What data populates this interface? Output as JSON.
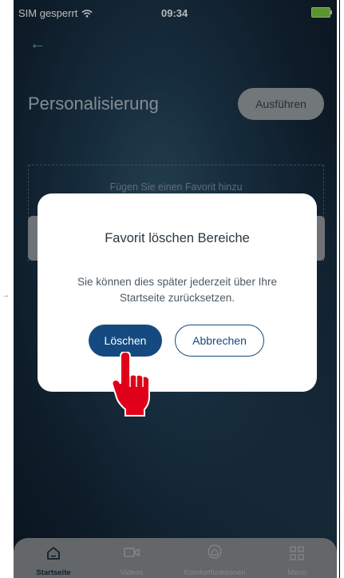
{
  "status_bar": {
    "carrier": "SIM gesperrt",
    "time": "09:34"
  },
  "header": {
    "back_icon": "arrow-left-icon",
    "title": "Personalisierung",
    "run_label": "Ausführen"
  },
  "favorites": {
    "hint": "Fügen Sie einen Favorit hinzu"
  },
  "dialog": {
    "title": "Favorit löschen Bereiche",
    "message": "Sie können dies später jederzeit über Ihre Startseite zurücksetzen.",
    "delete_label": "Löschen",
    "cancel_label": "Abbrechen"
  },
  "tabbar": {
    "items": [
      {
        "label": "Startseite",
        "icon": "home-icon",
        "active": true
      },
      {
        "label": "Videos",
        "icon": "video-icon",
        "active": false
      },
      {
        "label": "Komfortfunktionen",
        "icon": "comfort-icon",
        "active": false
      },
      {
        "label": "Menü",
        "icon": "grid-icon",
        "active": false
      }
    ]
  },
  "colors": {
    "primary": "#144a80",
    "accent_red": "#e0001a"
  }
}
